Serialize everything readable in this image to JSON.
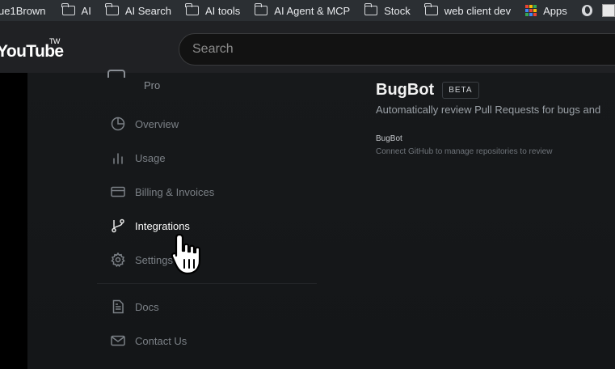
{
  "bookmarks": [
    {
      "label": "ue1Brown",
      "icon": "none"
    },
    {
      "label": "AI",
      "icon": "folder-icon"
    },
    {
      "label": "AI Search",
      "icon": "folder-icon"
    },
    {
      "label": "AI tools",
      "icon": "folder-icon"
    },
    {
      "label": "AI Agent & MCP",
      "icon": "folder-icon"
    },
    {
      "label": "Stock",
      "icon": "folder-icon"
    },
    {
      "label": "web client dev",
      "icon": "folder-icon"
    },
    {
      "label": "Apps",
      "icon": "apps-grid-icon"
    }
  ],
  "youtube": {
    "logo": "YouTube",
    "logo_tm": "TW",
    "search_placeholder": "Search"
  },
  "sidebar": {
    "plan": "Pro",
    "items": [
      {
        "label": "Overview",
        "icon": "pie-chart-icon"
      },
      {
        "label": "Usage",
        "icon": "bar-chart-icon"
      },
      {
        "label": "Billing & Invoices",
        "icon": "credit-card-icon"
      },
      {
        "label": "Integrations",
        "icon": "git-branch-icon",
        "active": true
      },
      {
        "label": "Settings",
        "icon": "gear-icon"
      },
      {
        "label": "Docs",
        "icon": "document-icon"
      },
      {
        "label": "Contact Us",
        "icon": "mail-icon"
      }
    ]
  },
  "content": {
    "title": "BugBot",
    "badge": "BETA",
    "subtitle": "Automatically review Pull Requests for bugs and",
    "section_heading": "BugBot",
    "section_desc": "Connect GitHub to manage repositories to review"
  },
  "colors": {
    "bookmark_bar": "#2b2f33",
    "header": "#202124",
    "main_bg": "#17191b",
    "active_text": "#ffffff",
    "muted_text": "#7b8086"
  }
}
